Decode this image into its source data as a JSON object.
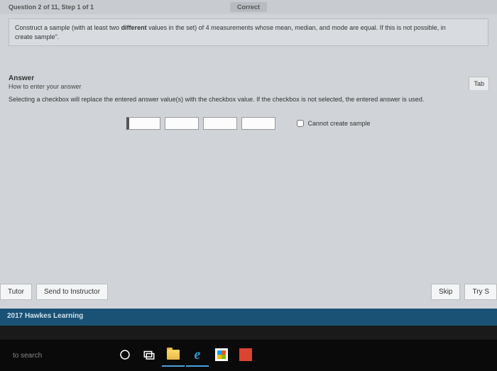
{
  "header": {
    "question_nav": "Question 2 of 11, Step 1 of 1",
    "status": "Correct"
  },
  "prompt": {
    "text_a": "Construct a sample (with at least two ",
    "bold": "different",
    "text_b": " values in the set) of 4 measurements whose mean, median, and mode are equal. If this is not possible, in",
    "text_c": "create sample\"."
  },
  "answer": {
    "title": "Answer",
    "hint": "How to enter your answer",
    "tab_label": "Tab",
    "instruction": "Selecting a checkbox will replace the entered answer value(s) with the checkbox value. If the checkbox is not selected, the entered answer is used.",
    "checkbox_label": "Cannot create sample"
  },
  "buttons": {
    "tutor": "Tutor",
    "send": "Send to Instructor",
    "skip": "Skip",
    "try": "Try S"
  },
  "footer": {
    "brand": "2017 Hawkes Learning"
  },
  "taskbar": {
    "search_placeholder": "to search"
  }
}
